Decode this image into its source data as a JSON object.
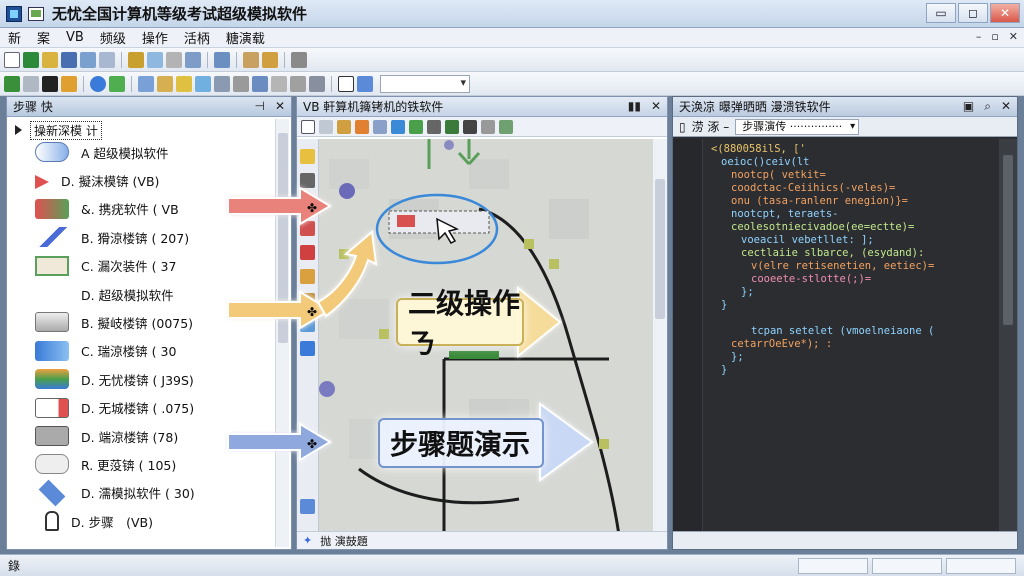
{
  "window": {
    "title": "无忧全国计算机等级考试超级模拟软件",
    "controls": [
      "▭",
      "◻",
      "✕"
    ]
  },
  "menubar": {
    "items": [
      "新",
      "案",
      "VB",
      "频级",
      "操作",
      "活柄",
      "糖演载"
    ],
    "controls": [
      "–",
      "▫",
      "✕"
    ]
  },
  "left_panel": {
    "title": "步骤 快",
    "controls": [
      "⊣",
      "✕"
    ],
    "root_label": "操新深模 计",
    "steps": [
      {
        "label": "A 超级模拟软件",
        "icon": "capsule-icon",
        "selected": true
      },
      {
        "label": "D. 擬沫模锛 (VB)",
        "icon": "pointer-arrow-icon"
      },
      {
        "label": "&. 携疣软件 ( VB",
        "icon": "double-arrow-icon"
      },
      {
        "label": "B. 猾涼楼锛 ( 207)",
        "icon": "slash-tool-icon"
      },
      {
        "label": "C. 漏次装件 ( 37",
        "icon": "package-icon"
      },
      {
        "label": "D. 超级模拟软件",
        "icon": "blank-icon"
      },
      {
        "label": "B. 擬岐楼锛 (0075)",
        "icon": "drive-icon"
      },
      {
        "label": "C. 瑞涼楼锛 ( 30",
        "icon": "folder-arrow-icon"
      },
      {
        "label": "D. 无忧楼锛 ( J39S)",
        "icon": "stack-icon"
      },
      {
        "label": "D. 无城楼锛 ( .075)",
        "icon": "battery-icon"
      },
      {
        "label": "D. 端涼楼锛 (78)",
        "icon": "plug-icon"
      },
      {
        "label": "R. 更莈锛 ( 105)",
        "icon": "cloud-icon"
      },
      {
        "label": "D. 濡模拟软件 ( 30)",
        "icon": "diamond-icon"
      },
      {
        "label": "D. 步骤　(VB)",
        "icon": "hand-icon"
      }
    ]
  },
  "middle_panel": {
    "title": "VB 軒算机篺铐机的铁软件",
    "controls": [
      "▮▮",
      "✕"
    ],
    "bottom_label": "抛 演鼓題"
  },
  "right_panel": {
    "title": "天涣凉 曝弹晒晒 漫溃铁软件",
    "controls": [
      "▣",
      "⌕",
      "✕"
    ],
    "tab_icon": "▯",
    "tab_text": "涝 涿 –",
    "dropdown_label": "步骤演传 ···············",
    "code_lines": [
      {
        "t": "<(880058ilS,   ['",
        "c": "c1",
        "i": 0
      },
      {
        "t": "oeioc()ceiv(lt",
        "c": "c2",
        "i": 1
      },
      {
        "t": "nootcp( vetkit=",
        "c": "c3",
        "i": 2
      },
      {
        "t": "coodctac-Ceiihics(-veles)=",
        "c": "c3",
        "i": 2
      },
      {
        "t": "onu (tasa-ranlenr enegion)}=",
        "c": "c3",
        "i": 2
      },
      {
        "t": "nootcpt, teraets-",
        "c": "c2",
        "i": 2
      },
      {
        "t": "ceolesotniecivadoe(ee=ectte)=",
        "c": "c4",
        "i": 2
      },
      {
        "t": "voeacil vebetllet:  ];",
        "c": "c2",
        "i": 3
      },
      {
        "t": "cectlaiie slbarce, (esydand):",
        "c": "c4",
        "i": 3
      },
      {
        "t": "v(elre retisenetien, eetiec)=",
        "c": "c3",
        "i": 4
      },
      {
        "t": "cooeete-stlotte(;)=",
        "c": "c5",
        "i": 4
      },
      {
        "t": "};",
        "c": "c2",
        "i": 3
      },
      {
        "t": "}",
        "c": "c2",
        "i": 1
      },
      {
        "t": "",
        "c": "c2",
        "i": 0
      },
      {
        "t": "tcpan setelet (vmoelneiaone (",
        "c": "c2",
        "i": 4
      },
      {
        "t": "cetarrOeEve*);  :",
        "c": "c3",
        "i": 2
      },
      {
        "t": "};",
        "c": "c2",
        "i": 2
      },
      {
        "t": "}",
        "c": "c2",
        "i": 1
      }
    ]
  },
  "overlays": {
    "banner_level2": "二级操作ㄋ",
    "banner_steps": "步骤题演示",
    "colors": {
      "arrow_red": "#e8827a",
      "arrow_yellow": "#f3c97a",
      "arrow_blue": "#8fa8dd",
      "ellipse": "#3a88d8"
    }
  },
  "statusbar": {
    "text": "錄"
  }
}
